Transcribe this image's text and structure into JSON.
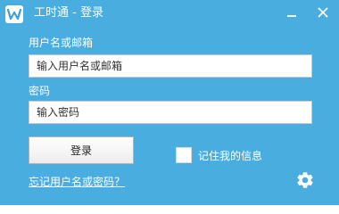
{
  "window": {
    "title": "工时通 - 登录",
    "app_icon": "w-logo-icon",
    "minimize_icon": "minimize-icon",
    "close_icon": "close-icon",
    "accent_color": "#4aaddf"
  },
  "form": {
    "username_label": "用户名或邮箱",
    "username_placeholder": "输入用户名或邮箱",
    "password_label": "密码",
    "password_placeholder": "输入密码",
    "login_button": "登录",
    "remember_label": "记住我的信息",
    "remember_checked": false,
    "forgot_link": "忘记用户名或密码？"
  },
  "footer": {
    "settings_icon": "gear-icon"
  }
}
